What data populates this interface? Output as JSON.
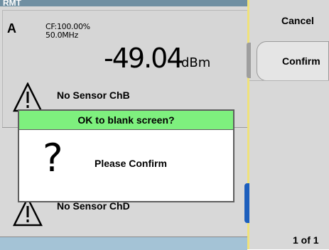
{
  "status": {
    "mode": "RMT"
  },
  "window_a": {
    "channel": "A",
    "cf_line1": "CF:100.00%",
    "cf_line2": "50.0MHz",
    "reading": "-49.04",
    "unit": "dBm",
    "sensor_message": "No Sensor ChB"
  },
  "window_b": {
    "sensor_message": "No Sensor ChD"
  },
  "dialog": {
    "title": "OK to blank screen?",
    "symbol": "?",
    "message": "Please Confirm"
  },
  "softkeys": {
    "cancel_label": "Cancel",
    "confirm_label": "Confirm",
    "page_indicator": "1 of 1"
  },
  "colors": {
    "dialog_title_bg": "#7ef07e",
    "status_bar": "#6f8fa2",
    "bottom_bar": "#a4c3d6",
    "accent_tab": "#1d5fbd"
  },
  "icons": [
    "warning-triangle-icon",
    "warning-triangle-icon"
  ]
}
